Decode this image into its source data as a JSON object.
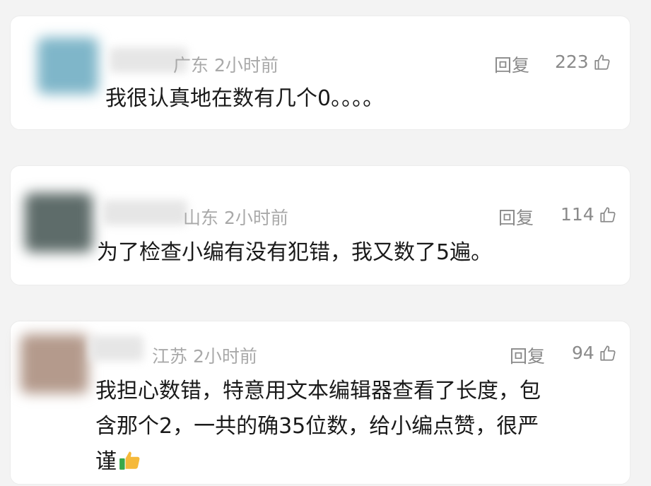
{
  "comments": [
    {
      "location": "广东",
      "time": "2小时前",
      "reply_label": "回复",
      "like_count": "223",
      "text": "我很认真地在数有几个0。。。。",
      "avatar_color": "#7fb6c9"
    },
    {
      "location": "山东",
      "time": "2小时前",
      "reply_label": "回复",
      "like_count": "114",
      "text": "为了检查小编有没有犯错，我又数了5遍。",
      "avatar_color": "#5e6c6a"
    },
    {
      "location": "江苏",
      "time": "2小时前",
      "reply_label": "回复",
      "like_count": "94",
      "text_line1": "我担心数错，特意用文本编辑器查看了长度，包",
      "text_line2": "含那个2，一共的确35位数，给小编点赞，很严",
      "text_line3": "谨",
      "emoji": "thumbs-up-emoji",
      "avatar_color": "#b49a8c"
    }
  ],
  "icons": {
    "like": "thumb-up-outline-icon"
  }
}
